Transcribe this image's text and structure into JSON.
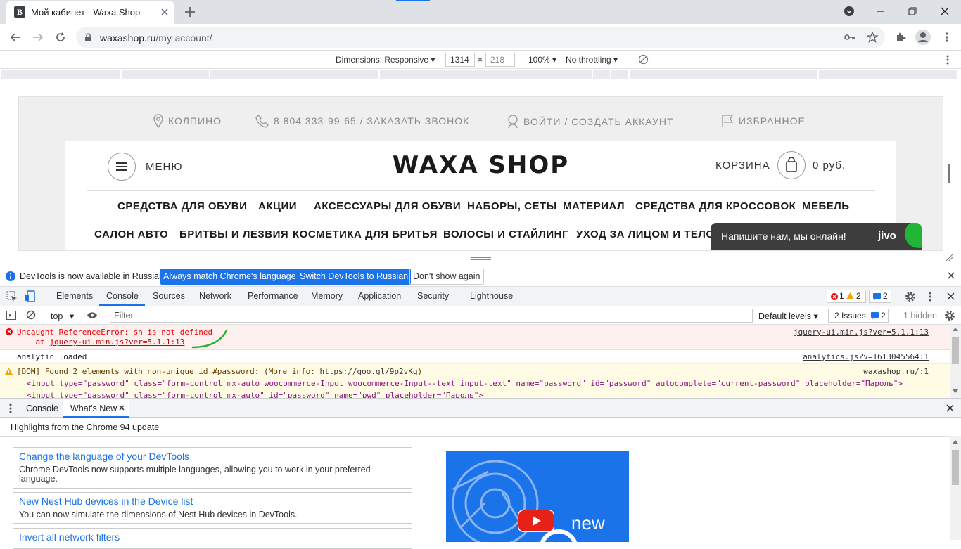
{
  "browser": {
    "tab_title": "Мой кабинет - Waxa Shop",
    "favicon_letter": "B",
    "url_host": "waxashop.ru",
    "url_path": "/my-account/"
  },
  "device_toolbar": {
    "dimensions_label": "Dimensions: Responsive",
    "width": "1314",
    "x": "×",
    "height": "218",
    "zoom": "100%",
    "throttling": "No throttling"
  },
  "site": {
    "top_bar": {
      "city": "КОЛПИНО",
      "phone": "8 804 333-99-65 / ЗАКАЗАТЬ ЗВОНОК",
      "login": "ВОЙТИ /  СОЗДАТЬ АККАУНТ",
      "favorites": "ИЗБРАННОЕ"
    },
    "menu_label": "МЕНЮ",
    "logo": "WAXA SHOP",
    "cart_label": "КОРЗИНА",
    "cart_sum": "0 руб.",
    "nav_row1": [
      "СРЕДСТВА ДЛЯ ОБУВИ",
      "АКЦИИ",
      "АКСЕССУАРЫ ДЛЯ ОБУВИ",
      "НАБОРЫ, СЕТЫ",
      "МАТЕРИАЛ",
      "СРЕДСТВА ДЛЯ КРОССОВОК",
      "МЕБЕЛЬ"
    ],
    "nav_row2": [
      "САЛОН АВТО",
      "БРИТВЫ И ЛЕЗВИЯ",
      "КОСМЕТИКА ДЛЯ БРИТЬЯ",
      "ВОЛОСЫ И СТАЙЛИНГ",
      "УХОД ЗА ЛИЦОМ И ТЕЛОМ"
    ],
    "jivo_text": "Напишите нам, мы онлайн!",
    "jivo_logo": "jivo"
  },
  "infobar": {
    "message": "DevTools is now available in Russian!",
    "btn_match": "Always match Chrome's language",
    "btn_switch": "Switch DevTools to Russian",
    "btn_dismiss": "Don't show again"
  },
  "devtools": {
    "tabs": [
      "Elements",
      "Console",
      "Sources",
      "Network",
      "Performance",
      "Memory",
      "Application",
      "Security",
      "Lighthouse"
    ],
    "errors_count": "1",
    "warnings_count": "2",
    "messages_count": "2",
    "context": "top",
    "filter_placeholder": "Filter",
    "levels": "Default levels",
    "issues_label": "2 Issues:",
    "issues_count": "2",
    "hidden": "1 hidden"
  },
  "console": {
    "error_line1": "Uncaught ReferenceError: sh is not defined",
    "error_line2_prefix": "    at ",
    "error_line2_link": "jquery-ui.min.js?ver=5.1.1:13",
    "error_source": "jquery-ui.min.js?ver=5.1.1:13",
    "info_text": "analytic loaded",
    "info_source": "analytics.js?v=1613045564:1",
    "warn_text": "[DOM] Found 2 elements with non-unique id #password: (More info: ",
    "warn_link": "https://goo.gl/9p2vKq",
    "warn_close": ")",
    "warn_source": "waxashop.ru/:1",
    "warn_line2": "<input type=\"password\" class=\"form-control mx-auto woocommerce-Input woocommerce-Input--text input-text\" name=\"password\" id=\"password\" autocomplete=\"current-password\" placeholder=\"Пароль\">",
    "warn_line3": "<input type=\"password\" class=\"form-control mx-auto\" id=\"password\" name=\"pwd\" placeholder=\"Пароль\">"
  },
  "drawer": {
    "tabs": [
      "Console",
      "What's New"
    ],
    "highlights": "Highlights from the Chrome 94 update",
    "cards": [
      {
        "title": "Change the language of your DevTools",
        "desc": "Chrome DevTools now supports multiple languages, allowing you to work in your preferred language."
      },
      {
        "title": "New Nest Hub devices in the Device list",
        "desc": "You can now simulate the dimensions of Nest Hub devices in DevTools."
      },
      {
        "title": "Invert all network filters",
        "desc": ""
      }
    ],
    "video_text": "new"
  },
  "colors": {
    "accent": "#1a73e8",
    "error": "#e00000",
    "jivo_bg": "#3d3d3d",
    "jivo_green": "#20b534"
  }
}
